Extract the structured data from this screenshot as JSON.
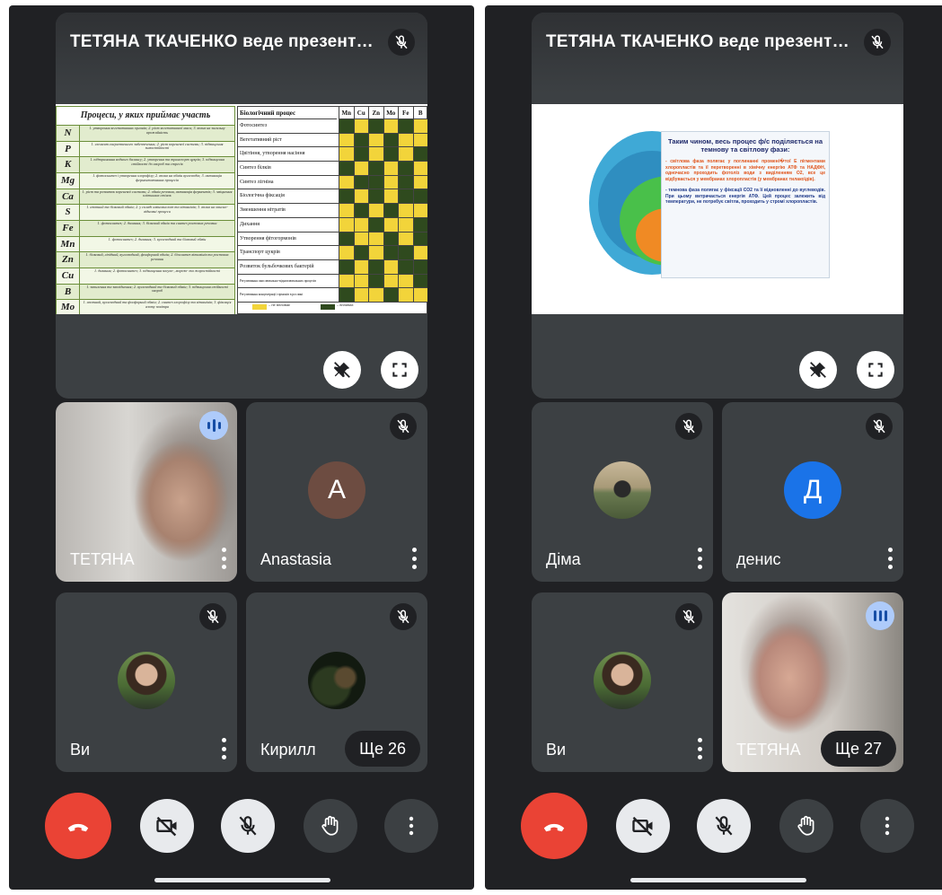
{
  "left": {
    "presentation": {
      "title": "ТЕТЯНА ТКАЧЕНКО веде презентац…",
      "slide": {
        "left_heading": "Процеси, у яких приймає участь",
        "elements": [
          {
            "el": "N",
            "text": "1. утворення вегетативних органів; 2. ріст вегетативної маси; 3. вплив на загальну врожайність"
          },
          {
            "el": "P",
            "text": "1. елемент енергетичного забезпечення; 2. ріст кореневої системи; 3. підвищення зимостійкості"
          },
          {
            "el": "K",
            "text": "1. підтримання водного балансу; 2. утворення та транспорт цукрів; 3. підвищення стійкості до хвороб та стресів"
          },
          {
            "el": "Mg",
            "text": "1. фотосинтез і утворення хлорофілу; 2. вплив на обмін вуглеводів; 3. активація ферментативних процесів"
          },
          {
            "el": "Ca",
            "text": "1. ріст та розвиток кореневої системи; 2. обмін речовин, активація ферментів; 3. зміцнення клітинних стінок"
          },
          {
            "el": "S",
            "text": "1. азотний та білковий обмін; 2. у складі амінокислот та вітамінів; 3. вплив на окисно-відновні процеси"
          },
          {
            "el": "Fe",
            "text": "1. фотосинтез; 2. дихання; 3. білковий обмін та синтез ростових речовин"
          },
          {
            "el": "Mn",
            "text": "1. фотосинтез; 2. дихання; 3. вуглеводний та білковий обмін"
          },
          {
            "el": "Zn",
            "text": "1. білковий, ліпідний, вуглеводний, фосфорний обмін; 2. біосинтез вітамінів та ростових речовин"
          },
          {
            "el": "Cu",
            "text": "1. дихання; 2. фотосинтез; 3. підвищення засухо-, морозо- та жаростійкості"
          },
          {
            "el": "B",
            "text": "1. запилення та запліднення; 2. вуглеводний та білковий обмін; 3. підвищення стійкості хвороб"
          },
          {
            "el": "Mo",
            "text": "1. азотний, вуглеводний та фосфорний обмін; 2. синтез хлорофілу та вітамінів; 3. фіксація азоту повітря"
          }
        ],
        "right_heading": "Біологічний процес",
        "columns": [
          "Mn",
          "Cu",
          "Zn",
          "Mo",
          "Fe",
          "B"
        ],
        "processes": [
          "Фотосинтез",
          "Вегетативний ріст",
          "Цвітіння, утворення насіння",
          "Синтез білків",
          "Синтез лігніна",
          "Біологічна фіксація",
          "Зменшення нітратів",
          "Дихання",
          "Утворення фітогормонів",
          "Транспорт цукрів",
          "Розвиток бульбочкових бактерій",
          "Регулювання окислювально-відновлювальних процесів",
          "Регулювання концентрації гормонів в рослині"
        ],
        "legend": [
          "– не впливає",
          "– впливає"
        ]
      }
    },
    "tiles": [
      {
        "name": "ТЕТЯНА"
      },
      {
        "name": "Anastasia",
        "initial": "A"
      },
      {
        "name": "Ви"
      },
      {
        "name": "Кирилл",
        "more": "Ще 26"
      }
    ]
  },
  "right": {
    "presentation": {
      "title": "ТЕТЯНА ТКАЧЕНКО веде презентац…",
      "slide": {
        "heading": "Таким чином, весь процес ф/с поділяється на темнову та світлову фази:",
        "light_phase": "- світлова фаза полягає у поглинанні промені�тої Е пігментами хлоропластів та її перетворенні в хімічну енергію АТФ та НАДФН, одночасно проходить фотоліз води з виділенням О2, все це відбувається у мембранах хлоропластів (у мембранах тилакоїдів).",
        "dark_phase": "- темнова фаза полягає у фіксації СО2 та її відновленні до вуглеводів. При цьому витрачається енергія АТФ. Цей процес залежить від температури, не потребує світла, проходить у стромі хлоропластів."
      }
    },
    "tiles": [
      {
        "name": "Діма"
      },
      {
        "name": "денис",
        "initial": "Д"
      },
      {
        "name": "Ви"
      },
      {
        "name": "ТЕТЯНА",
        "more": "Ще 27"
      }
    ]
  },
  "colors": {
    "end_call": "#ea4335",
    "tile": "#3c4043",
    "background": "#202124",
    "avatar_anastasia": "#6d4c41",
    "avatar_denys": "#1a73e8",
    "speaking": "#aecbfa"
  }
}
